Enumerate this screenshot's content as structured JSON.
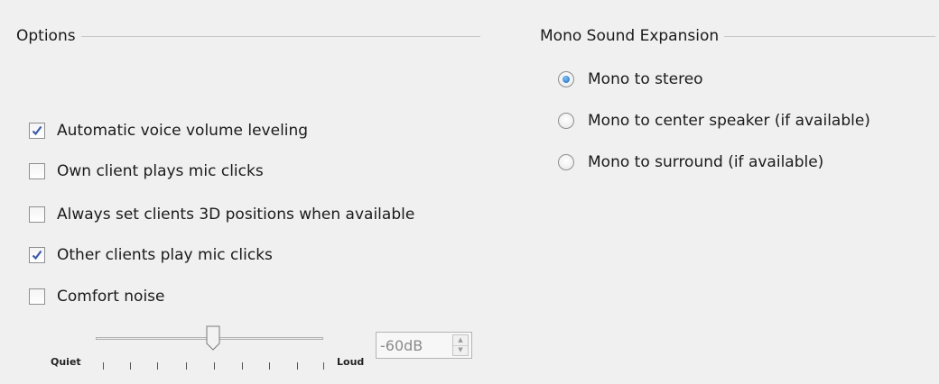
{
  "options": {
    "title": "Options",
    "checkboxes": [
      {
        "label": "Automatic voice volume leveling",
        "checked": true
      },
      {
        "label": "Own client plays mic clicks",
        "checked": false
      },
      {
        "label": "Always set clients 3D positions when available",
        "checked": false
      },
      {
        "label": "Other clients play mic clicks",
        "checked": true
      },
      {
        "label": "Comfort noise",
        "checked": false
      }
    ],
    "slider": {
      "min_label": "Quiet",
      "max_label": "Loud",
      "level": 0.5
    },
    "spin_value": "-60dB"
  },
  "mono": {
    "title": "Mono Sound Expansion",
    "radios": [
      {
        "label": "Mono to stereo",
        "selected": true
      },
      {
        "label": "Mono to center speaker (if available)",
        "selected": false
      },
      {
        "label": "Mono to surround (if available)",
        "selected": false
      }
    ]
  },
  "colors": {
    "check": "#3a5aa8",
    "radio_selected": "#1565c0"
  }
}
